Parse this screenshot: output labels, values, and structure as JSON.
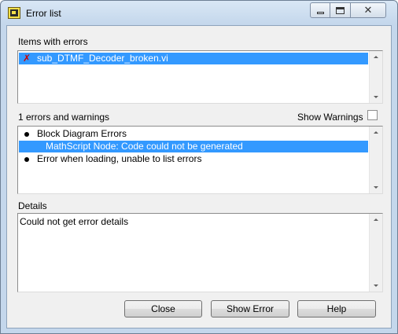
{
  "window": {
    "title": "Error list",
    "app_icon": "labview-vi-icon",
    "controls": {
      "minimize": "minimize-icon",
      "maximize": "maximize-icon",
      "close": "✕"
    }
  },
  "items_section": {
    "label": "Items with errors",
    "items": [
      {
        "text": "sub_DTMF_Decoder_broken.vi",
        "icon": "error-x-icon",
        "selected": true
      }
    ]
  },
  "errors_section": {
    "label": "1 errors and warnings",
    "show_warnings_label": "Show Warnings",
    "show_warnings_checked": false,
    "items": [
      {
        "text": "Block Diagram Errors",
        "bullet": true,
        "selected": false
      },
      {
        "text": "MathScript Node: Code could not be generated",
        "bullet": false,
        "selected": true
      },
      {
        "text": "Error when loading, unable to list errors",
        "bullet": true,
        "selected": false
      }
    ]
  },
  "details_section": {
    "label": "Details",
    "text": "Could not get error details"
  },
  "buttons": {
    "close": "Close",
    "show_error": "Show Error",
    "help": "Help"
  },
  "colors": {
    "selection": "#3399ff",
    "error_icon": "#cc0000",
    "title_bar": "#c4d7ec"
  }
}
